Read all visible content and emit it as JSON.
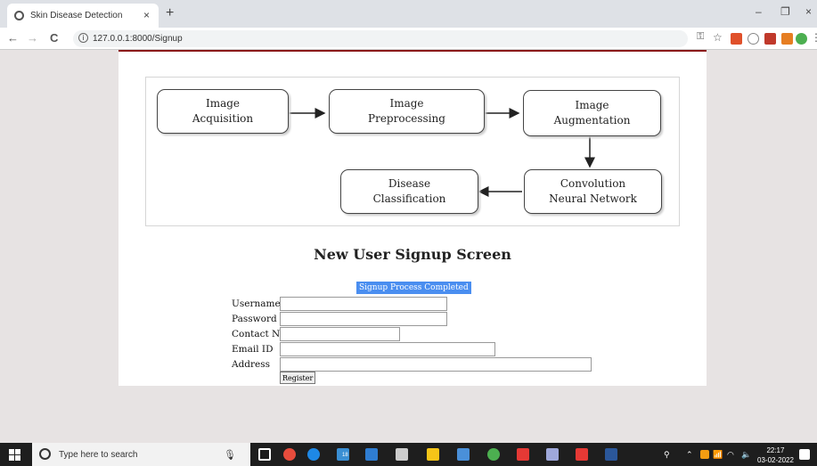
{
  "browser": {
    "tab_title": "Skin Disease Detection",
    "tab_close": "×",
    "new_tab": "+",
    "url": "127.0.0.1:8000/Signup",
    "info": "i",
    "minimize": "–",
    "restore": "❐",
    "close": "×",
    "back": "←",
    "forward": "→",
    "reload": "C"
  },
  "diagram": {
    "nodes": [
      "Image\nAcquisition",
      "Image\nPreprocessing",
      "Image\nAugmentation",
      "Convolution\nNeural Network",
      "Disease\nClassification"
    ]
  },
  "page": {
    "heading": "New User Signup Screen",
    "status": "Signup Process Completed",
    "form": {
      "username_label": "Username",
      "password_label": "Password",
      "contact_label": "Contact No",
      "email_label": "Email ID",
      "address_label": "Address",
      "username_value": "",
      "password_value": "",
      "contact_value": "",
      "email_value": "",
      "address_value": "",
      "register_label": "Register"
    }
  },
  "taskbar": {
    "search_placeholder": "Type here to search",
    "time": "22:17",
    "date": "03-02-2022",
    "badge": "18"
  },
  "colors": {
    "status_bg": "#4a8ef0",
    "header_line": "#8b1a1a"
  }
}
